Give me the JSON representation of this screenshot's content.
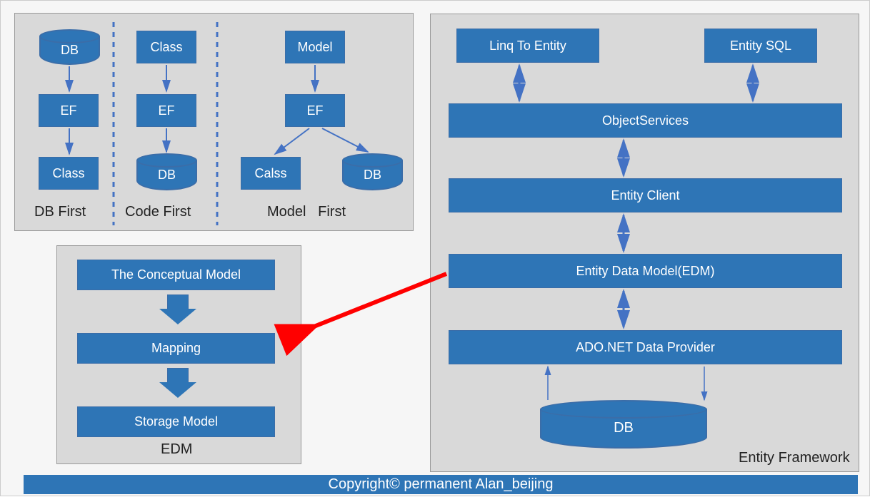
{
  "colors": {
    "fill": "#2e75b6",
    "outline": "#3b6da8",
    "panel": "#d9d9d9",
    "arrow": "#4472c4",
    "red": "#ff0000"
  },
  "topPanel": {
    "dbFirst": {
      "db": "DB",
      "ef": "EF",
      "class": "Class",
      "title": "DB First"
    },
    "codeFirst": {
      "class": "Class",
      "ef": "EF",
      "db": "DB",
      "title": "Code First"
    },
    "modelFirst": {
      "model": "Model",
      "ef": "EF",
      "class": "Calss",
      "db": "DB",
      "title": "Model   First"
    }
  },
  "edmPanel": {
    "conceptual": "The Conceptual Model",
    "mapping": "Mapping",
    "storage": "Storage Model",
    "title": "EDM"
  },
  "rightPanel": {
    "linq": "Linq To Entity",
    "esql": "Entity SQL",
    "objectServices": "ObjectServices",
    "entityClient": "Entity Client",
    "edm": "Entity Data Model(EDM)",
    "adonet": "ADO.NET Data Provider",
    "db": "DB",
    "title": "Entity Framework"
  },
  "footer": "Copyright© permanent  Alan_beijing"
}
